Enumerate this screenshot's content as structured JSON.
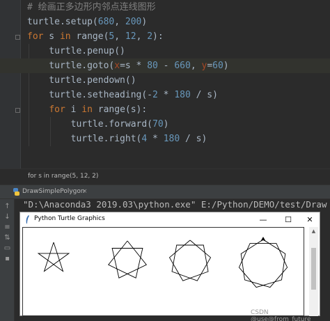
{
  "editor": {
    "lines": [
      {
        "tokens": [
          {
            "cls": "t-comment",
            "text": "# 绘画正多边形内邻点连线图形"
          }
        ]
      },
      {
        "tokens": [
          {
            "cls": "t-plain",
            "text": "turtle.setup("
          },
          {
            "cls": "t-number",
            "text": "680"
          },
          {
            "cls": "t-plain",
            "text": ", "
          },
          {
            "cls": "t-number",
            "text": "200"
          },
          {
            "cls": "t-plain",
            "text": ")"
          }
        ]
      },
      {
        "tokens": [
          {
            "cls": "t-keyword",
            "text": "for"
          },
          {
            "cls": "t-plain",
            "text": " s "
          },
          {
            "cls": "t-keyword",
            "text": "in"
          },
          {
            "cls": "t-plain",
            "text": " range("
          },
          {
            "cls": "t-number",
            "text": "5"
          },
          {
            "cls": "t-plain",
            "text": ", "
          },
          {
            "cls": "t-number",
            "text": "12"
          },
          {
            "cls": "t-plain",
            "text": ", "
          },
          {
            "cls": "t-number",
            "text": "2"
          },
          {
            "cls": "t-plain",
            "text": "):"
          }
        ]
      },
      {
        "tokens": [
          {
            "cls": "t-plain",
            "text": "    turtle.penup()"
          }
        ]
      },
      {
        "tokens": [
          {
            "cls": "t-plain",
            "text": "    turtle.goto("
          },
          {
            "cls": "t-param",
            "text": "x"
          },
          {
            "cls": "t-plain",
            "text": "=s * "
          },
          {
            "cls": "t-number",
            "text": "80"
          },
          {
            "cls": "t-plain",
            "text": " - "
          },
          {
            "cls": "t-number",
            "text": "660"
          },
          {
            "cls": "t-plain",
            "text": ", "
          },
          {
            "cls": "t-param",
            "text": "y"
          },
          {
            "cls": "t-plain",
            "text": "="
          },
          {
            "cls": "t-number",
            "text": "60"
          },
          {
            "cls": "t-plain",
            "text": ")"
          }
        ]
      },
      {
        "tokens": [
          {
            "cls": "t-plain",
            "text": "    turtle.pendown()"
          }
        ]
      },
      {
        "tokens": [
          {
            "cls": "t-plain",
            "text": "    turtle.setheading(-"
          },
          {
            "cls": "t-number",
            "text": "2"
          },
          {
            "cls": "t-plain",
            "text": " * "
          },
          {
            "cls": "t-number",
            "text": "180"
          },
          {
            "cls": "t-plain",
            "text": " / s)"
          }
        ]
      },
      {
        "tokens": [
          {
            "cls": "t-plain",
            "text": "    "
          },
          {
            "cls": "t-keyword",
            "text": "for"
          },
          {
            "cls": "t-plain",
            "text": " i "
          },
          {
            "cls": "t-keyword",
            "text": "in"
          },
          {
            "cls": "t-plain",
            "text": " range(s):"
          }
        ]
      },
      {
        "tokens": [
          {
            "cls": "t-plain",
            "text": "        turtle.forward("
          },
          {
            "cls": "t-number",
            "text": "70"
          },
          {
            "cls": "t-plain",
            "text": ")"
          }
        ]
      },
      {
        "tokens": [
          {
            "cls": "t-plain",
            "text": "        turtle.right("
          },
          {
            "cls": "t-number",
            "text": "4"
          },
          {
            "cls": "t-plain",
            "text": " * "
          },
          {
            "cls": "t-number",
            "text": "180"
          },
          {
            "cls": "t-plain",
            "text": " / s)"
          }
        ]
      }
    ],
    "current_line": 4
  },
  "breadcrumb": {
    "text": "for s in range(5, 12, 2)"
  },
  "run_panel": {
    "tab_label": "DrawSimplePolygon",
    "tab_close": "×",
    "console_text": "\"D:\\Anaconda3 2019.03\\python.exe\" E:/Python/DEMO/test/Draw",
    "toolbar": [
      "arrow-up-icon",
      "arrow-down-icon",
      "soft-wrap-icon",
      "sort-icon",
      "print-icon",
      "trash-icon"
    ]
  },
  "turtle_window": {
    "title": "Python Turtle Graphics",
    "minimize": "—",
    "maximize": "☐",
    "close": "✕",
    "polygons": [
      {
        "sides": 5,
        "step": 2
      },
      {
        "sides": 7,
        "step": 2
      },
      {
        "sides": 9,
        "step": 2
      },
      {
        "sides": 11,
        "step": 2
      }
    ]
  },
  "watermark": "CSDN @use@from_future"
}
